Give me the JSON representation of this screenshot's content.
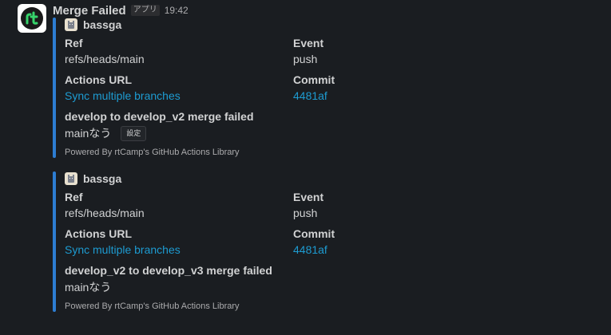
{
  "header": {
    "sender": "Merge Failed",
    "app_badge": "アプリ",
    "timestamp": "19:42"
  },
  "colors": {
    "background": "#1a1d21",
    "attachment_bar": "#2d7dd2",
    "link": "#1d9bd1"
  },
  "attachments": [
    {
      "author": "bassga",
      "fields": {
        "ref_title": "Ref",
        "ref_value": "refs/heads/main",
        "event_title": "Event",
        "event_value": "push",
        "actions_url_title": "Actions URL",
        "actions_url_value": "Sync multiple branches",
        "commit_title": "Commit",
        "commit_value": "4481af"
      },
      "merge_title": "develop to develop_v2 merge failed",
      "merge_text": "mainなう",
      "button_label": "設定",
      "footer": "Powered By rtCamp's GitHub Actions Library"
    },
    {
      "author": "bassga",
      "fields": {
        "ref_title": "Ref",
        "ref_value": "refs/heads/main",
        "event_title": "Event",
        "event_value": "push",
        "actions_url_title": "Actions URL",
        "actions_url_value": "Sync multiple branches",
        "commit_title": "Commit",
        "commit_value": "4481af"
      },
      "merge_title": "develop_v2 to develop_v3 merge failed",
      "merge_text": "mainなう",
      "footer": "Powered By rtCamp's GitHub Actions Library"
    }
  ]
}
